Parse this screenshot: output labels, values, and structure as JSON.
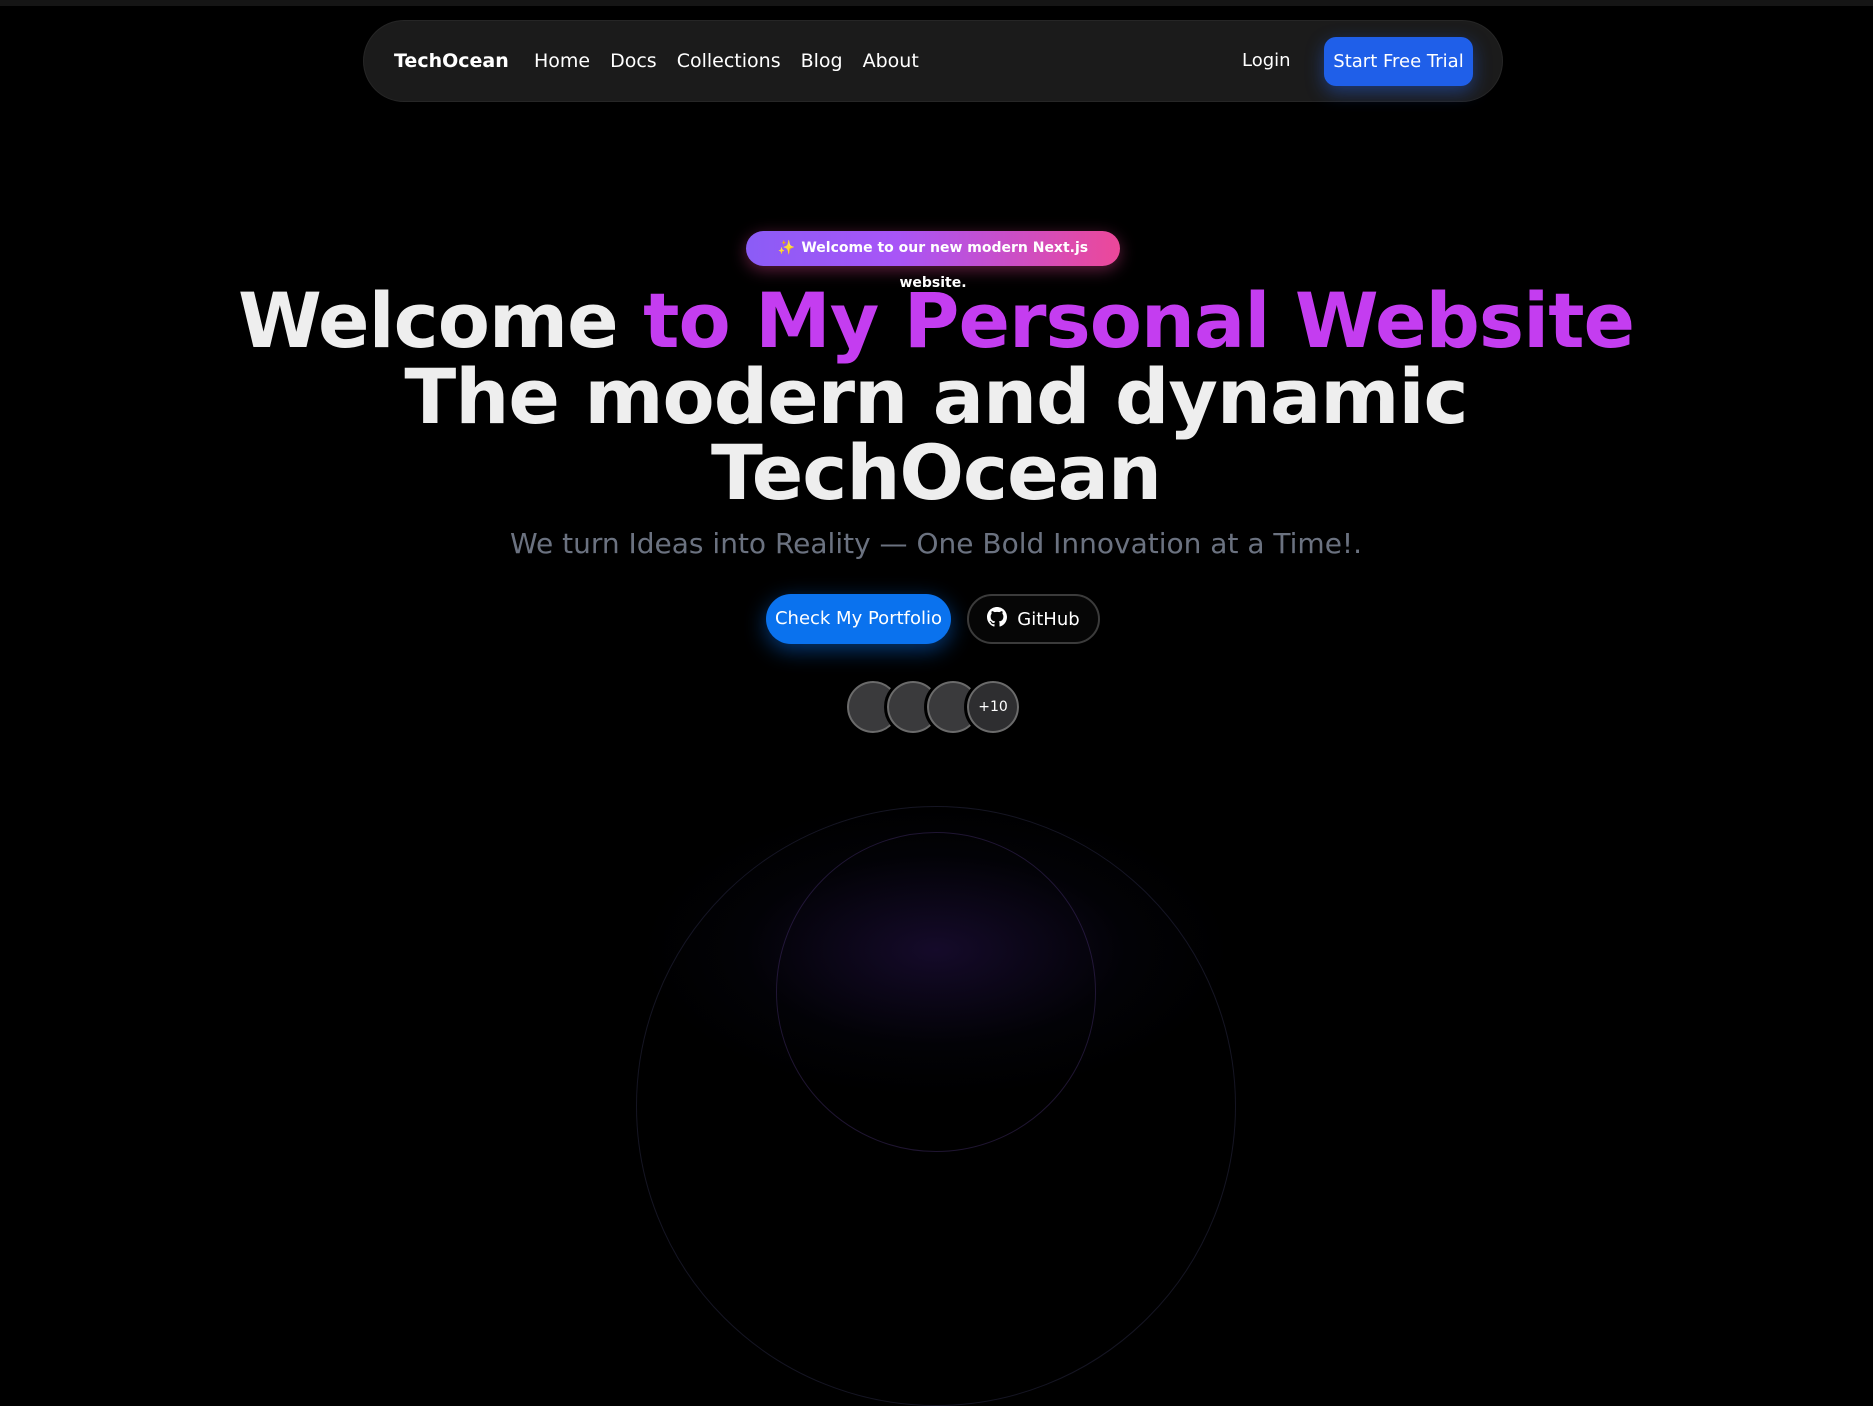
{
  "nav": {
    "brand": "TechOcean",
    "links": [
      "Home",
      "Docs",
      "Collections",
      "Blog",
      "About"
    ],
    "login": "Login",
    "cta": "Start Free Trial"
  },
  "hero": {
    "announcement_icon": "✨",
    "announcement": "Welcome to our new modern Next.js website.",
    "headline_part1": "Welcome ",
    "headline_highlight": "to My Personal Website",
    "headline_line2": "The modern and dynamic",
    "headline_line3": "TechOcean",
    "subtitle": "We turn Ideas into Reality — One Bold Innovation at a Time!.",
    "primary_button": "Check My Portfolio",
    "secondary_button": "GitHub",
    "secondary_button_icon": "github-icon",
    "avatars_more": "+10"
  },
  "colors": {
    "background": "#000000",
    "accent_blue": "#0a72ee",
    "cta_blue": "#1f5fe9",
    "highlight_purple": "#c43df0"
  }
}
